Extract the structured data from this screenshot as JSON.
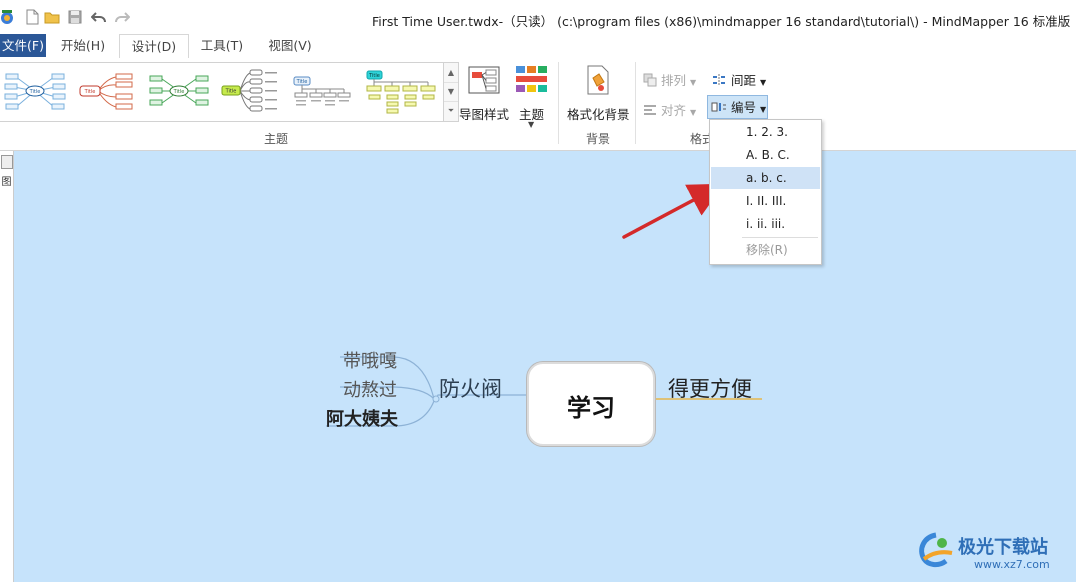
{
  "window": {
    "title": "First Time User.twdx-（只读）  (c:\\program files (x86)\\mindmapper 16 standard\\tutorial\\) - MindMapper 16 标准版"
  },
  "tabs": [
    {
      "id": "file",
      "label": "文件(F)",
      "active": false
    },
    {
      "id": "home",
      "label": "开始(H)",
      "active": false
    },
    {
      "id": "design",
      "label": "设计(D)",
      "active": true
    },
    {
      "id": "tools",
      "label": "工具(T)",
      "active": false
    },
    {
      "id": "view",
      "label": "视图(V)",
      "active": false
    }
  ],
  "ribbon": {
    "theme_group_label": "主题",
    "map_style_label": "导图样式",
    "theme_label": "主题",
    "format_bg_label": "格式化背景",
    "bg_group_label": "背景",
    "format_group_label": "格式",
    "arrange_label": "排列",
    "align_label": "对齐",
    "spacing_label": "间距",
    "numbering_label": "编号",
    "thumb_title": "Title"
  },
  "numbering_menu": {
    "items": [
      {
        "label": "1. 2. 3.",
        "highlighted": false,
        "disabled": false
      },
      {
        "label": "A. B. C.",
        "highlighted": false,
        "disabled": false
      },
      {
        "label": "a. b. c.",
        "highlighted": true,
        "disabled": false
      },
      {
        "label": "I. II. III.",
        "highlighted": false,
        "disabled": false
      },
      {
        "label": "i. ii. iii.",
        "highlighted": false,
        "disabled": false
      }
    ],
    "remove_label": "移除(R)"
  },
  "left_panel": {
    "label": "图"
  },
  "mindmap": {
    "central": "学习",
    "right_topic": "得更方便",
    "left_topic": "防火阀",
    "left_subtopics": [
      "带哦嘎",
      "动熬过",
      "阿大姨夫"
    ]
  },
  "watermark": {
    "name": "极光下载站",
    "url": "www.xz7.com"
  },
  "colors": {
    "canvas_bg": "#c6e3fb",
    "file_tab": "#2b5797",
    "menu_highlight": "#cfe2f6",
    "annotation_arrow": "#d42a2a",
    "right_branch": "#e6b74c",
    "left_branch": "#8db2d6"
  }
}
